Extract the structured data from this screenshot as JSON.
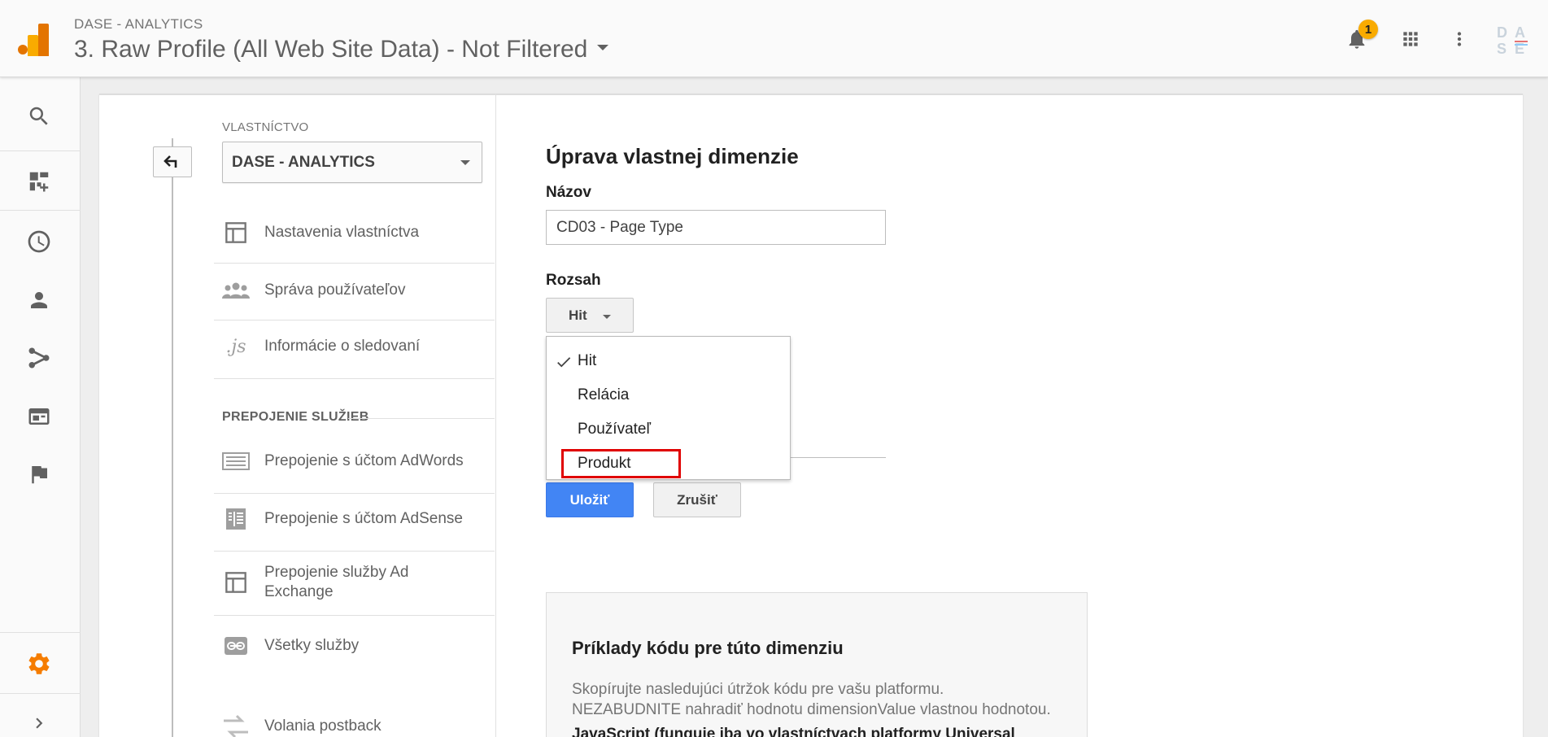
{
  "header": {
    "account_label": "DASE - ANALYTICS",
    "view_title": "3. Raw Profile (All Web Site Data) - Not Filtered",
    "notification_count": "1",
    "avatar_text": "DASE"
  },
  "leftnav": {
    "items": [
      "search-icon",
      "customization-icon",
      "realtime-icon",
      "audience-icon",
      "acquisition-icon",
      "behavior-icon",
      "conversions-icon"
    ],
    "admin_icon": "gear-icon",
    "expand_icon": "chevron-right-icon",
    "accent_color": "#f57c00"
  },
  "admin": {
    "column_label": "VLASTNÍCTVO",
    "property_name": "DASE - ANALYTICS",
    "items": [
      {
        "label": "Nastavenia vlastníctva",
        "icon": "property-settings-icon"
      },
      {
        "label": "Správa používateľov",
        "icon": "users-icon"
      },
      {
        "label": "Informácie o sledovaní",
        "icon": "js-icon"
      }
    ],
    "section_heading": "PREPOJENIE SLUŽIEB",
    "links": [
      {
        "label": "Prepojenie s účtom AdWords",
        "icon": "adwords-icon"
      },
      {
        "label": "Prepojenie s účtom AdSense",
        "icon": "adsense-icon"
      },
      {
        "label": "Prepojenie služby Ad Exchange",
        "icon": "ad-exchange-icon"
      },
      {
        "label": "Všetky služby",
        "icon": "link-icon"
      },
      {
        "label": "Volania postback",
        "icon": "postback-icon"
      }
    ]
  },
  "form": {
    "title": "Úprava vlastnej dimenzie",
    "name_label": "Názov",
    "name_value": "CD03 - Page Type",
    "scope_label": "Rozsah",
    "scope_selected": "Hit",
    "scope_options": [
      "Hit",
      "Relácia",
      "Používateľ",
      "Produkt"
    ],
    "save_label": "Uložiť",
    "cancel_label": "Zrušiť",
    "primary_color": "#4285f4",
    "highlight_color": "#e00000"
  },
  "examples": {
    "title": "Príklady kódu pre túto dimenziu",
    "description_line1": "Skopírujte nasledujúci útržok kódu pre vašu platformu.",
    "description_line2": "NEZABUDNITE nahradiť hodnotu dimensionValue vlastnou hodnotou.",
    "subheading": "JavaScript (funguje iba vo vlastníctvach platformy Universal"
  }
}
